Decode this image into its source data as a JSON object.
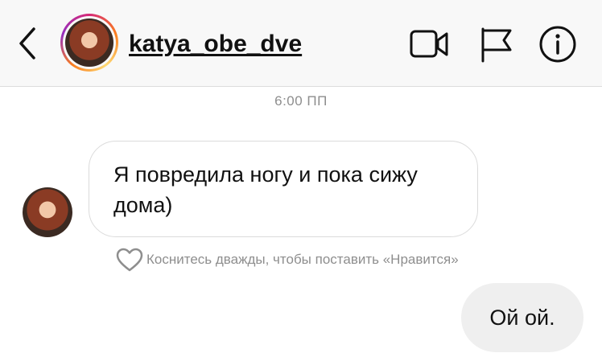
{
  "header": {
    "username": "katya_obe_dve",
    "icons": [
      "back-chevron-icon",
      "video-call-icon",
      "report-flag-icon",
      "info-icon"
    ]
  },
  "thread": {
    "timestamp": "6:00 ПП",
    "incoming_message": "Я повредила ногу и пока сижу дома)",
    "like_hint": "Коснитесь дважды, чтобы поставить «Нравится»",
    "outgoing_message": "Ой ой."
  },
  "colors": {
    "header_bg": "#f8f8f8",
    "outgoing_bubble": "#efefef",
    "incoming_border": "#dbdbdb",
    "muted_text": "#8e8e8e"
  }
}
